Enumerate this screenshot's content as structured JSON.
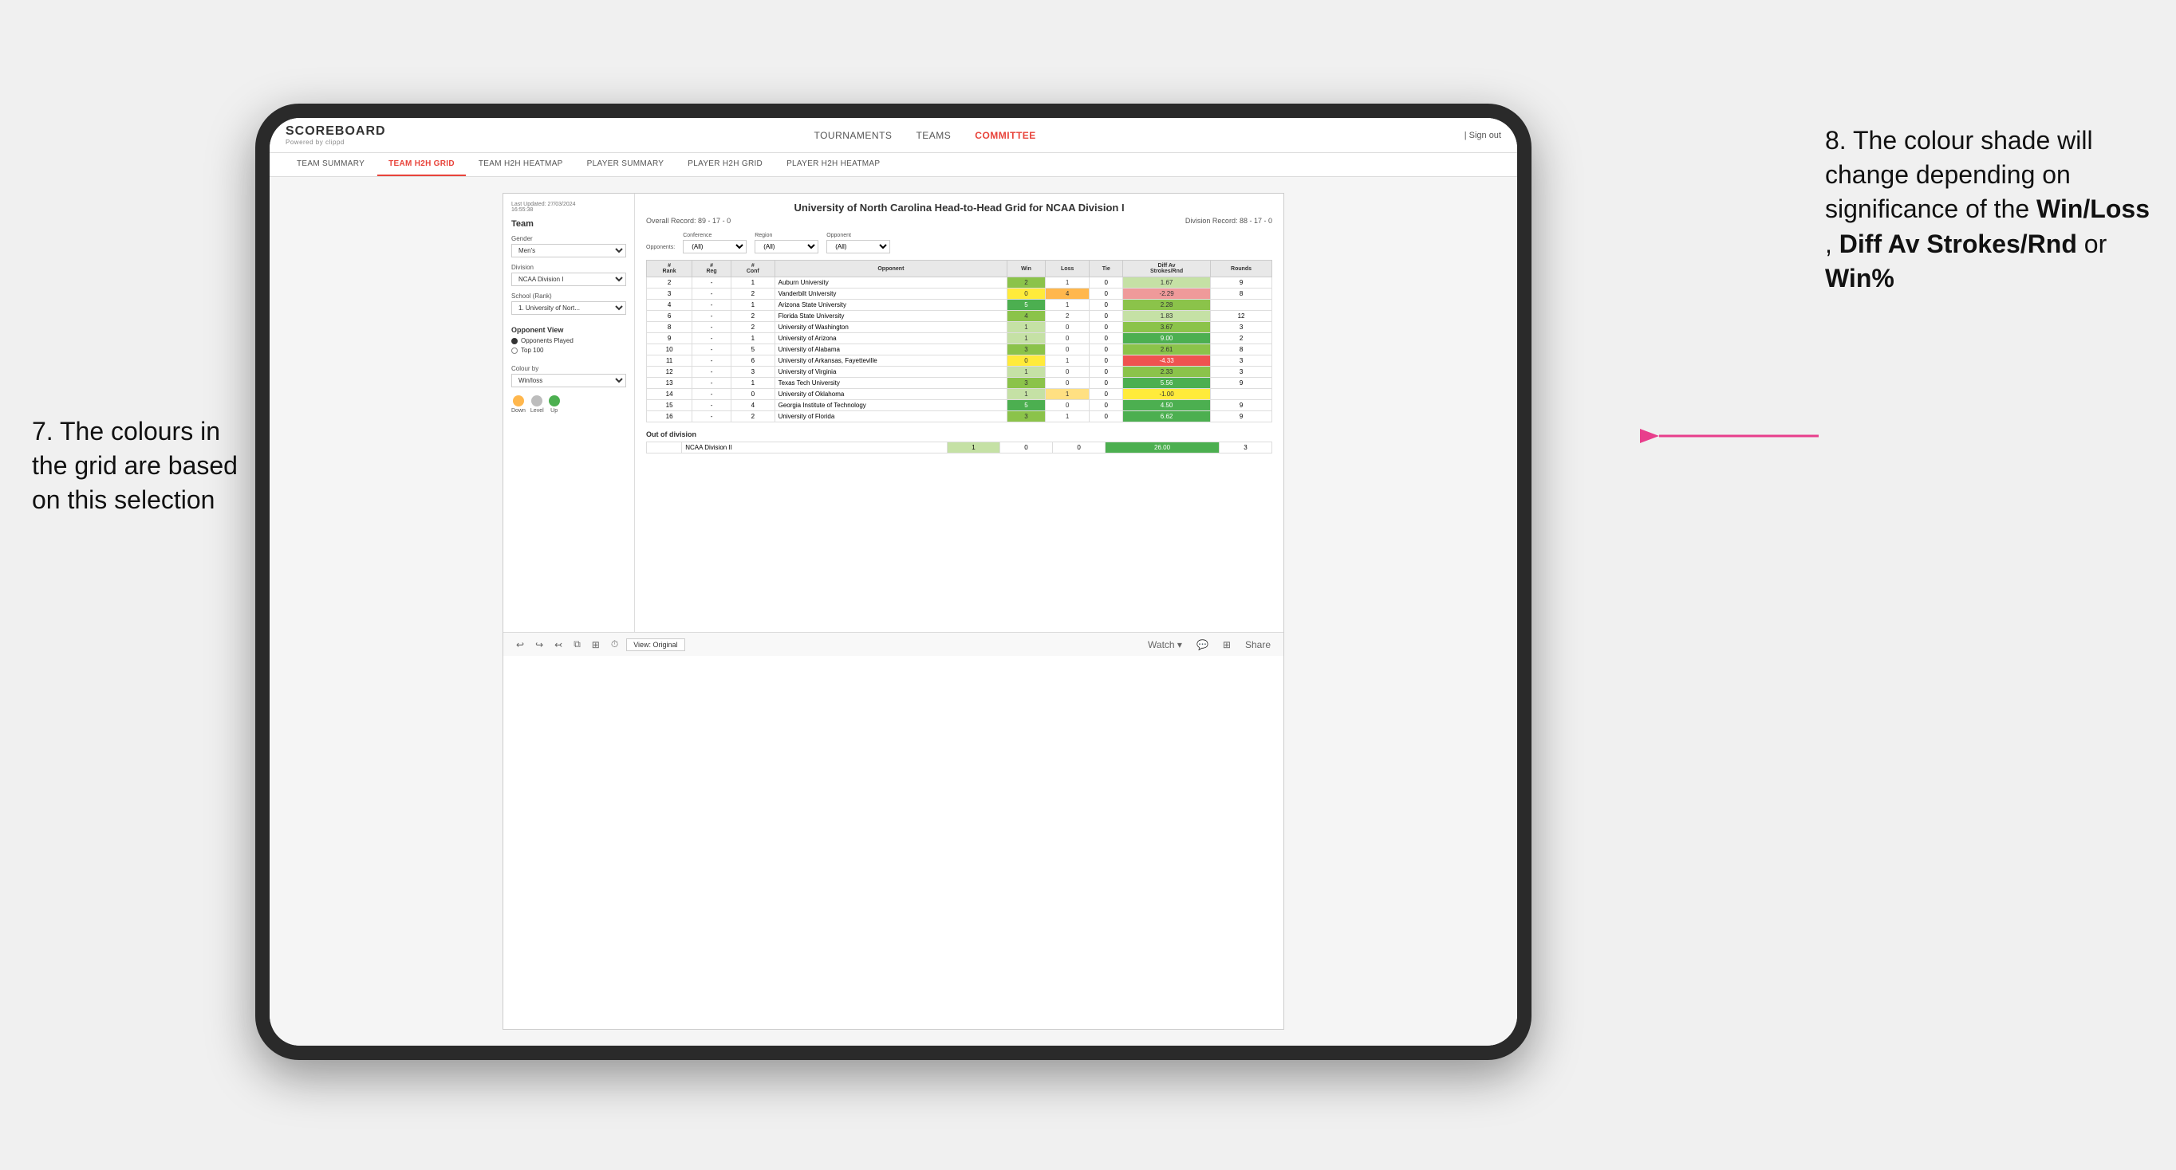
{
  "annotations": {
    "left": {
      "number": "7.",
      "text": "The colours in the grid are based on this selection"
    },
    "right": {
      "number": "8.",
      "text": " The colour shade will change depending on significance of the ",
      "bold1": "Win/Loss",
      "comma1": ", ",
      "bold2": "Diff Av Strokes/Rnd",
      "or": " or ",
      "bold3": "Win%"
    }
  },
  "nav": {
    "logo": "SCOREBOARD",
    "logo_sub": "Powered by clippd",
    "links": [
      "TOURNAMENTS",
      "TEAMS",
      "COMMITTEE"
    ],
    "sign_out": "| Sign out"
  },
  "sub_tabs": [
    "TEAM SUMMARY",
    "TEAM H2H GRID",
    "TEAM H2H HEATMAP",
    "PLAYER SUMMARY",
    "PLAYER H2H GRID",
    "PLAYER H2H HEATMAP"
  ],
  "active_sub_tab": "TEAM H2H GRID",
  "report": {
    "last_updated_label": "Last Updated: 27/03/2024",
    "last_updated_time": "16:55:38",
    "title": "University of North Carolina Head-to-Head Grid for NCAA Division I",
    "overall_record_label": "Overall Record:",
    "overall_record": "89 - 17 - 0",
    "division_record_label": "Division Record:",
    "division_record": "88 - 17 - 0"
  },
  "sidebar": {
    "team_label": "Team",
    "gender_label": "Gender",
    "gender_value": "Men's",
    "division_label": "Division",
    "division_value": "NCAA Division I",
    "school_label": "School (Rank)",
    "school_value": "1. University of Nort...",
    "opponent_view_label": "Opponent View",
    "opponent_options": [
      "Opponents Played",
      "Top 100"
    ],
    "opponent_selected": "Opponents Played",
    "colour_by_label": "Colour by",
    "colour_by_value": "Win/loss",
    "legend": {
      "down": "Down",
      "level": "Level",
      "up": "Up"
    }
  },
  "filters": {
    "opponents_label": "Opponents:",
    "conference_label": "Conference",
    "conference_value": "(All)",
    "region_label": "Region",
    "region_value": "(All)",
    "opponent_label": "Opponent",
    "opponent_value": "(All)"
  },
  "table": {
    "headers": [
      "#\nRank",
      "#\nReg",
      "#\nConf",
      "Opponent",
      "Win",
      "Loss",
      "Tie",
      "Diff Av\nStrokes/Rnd",
      "Rounds"
    ],
    "rows": [
      {
        "rank": "2",
        "reg": "-",
        "conf": "1",
        "opponent": "Auburn University",
        "win": "2",
        "loss": "1",
        "tie": "0",
        "diff": "1.67",
        "rounds": "9",
        "win_color": "green_mid",
        "loss_color": "white",
        "diff_color": "green_light"
      },
      {
        "rank": "3",
        "reg": "-",
        "conf": "2",
        "opponent": "Vanderbilt University",
        "win": "0",
        "loss": "4",
        "tie": "0",
        "diff": "-2.29",
        "rounds": "8",
        "win_color": "yellow",
        "loss_color": "orange",
        "diff_color": "red_light"
      },
      {
        "rank": "4",
        "reg": "-",
        "conf": "1",
        "opponent": "Arizona State University",
        "win": "5",
        "loss": "1",
        "tie": "0",
        "diff": "2.28",
        "rounds": "",
        "win_color": "green_dark",
        "loss_color": "white",
        "diff_color": "green_mid"
      },
      {
        "rank": "6",
        "reg": "-",
        "conf": "2",
        "opponent": "Florida State University",
        "win": "4",
        "loss": "2",
        "tie": "0",
        "diff": "1.83",
        "rounds": "12",
        "win_color": "green_mid",
        "loss_color": "white",
        "diff_color": "green_light"
      },
      {
        "rank": "8",
        "reg": "-",
        "conf": "2",
        "opponent": "University of Washington",
        "win": "1",
        "loss": "0",
        "tie": "0",
        "diff": "3.67",
        "rounds": "3",
        "win_color": "green_light",
        "loss_color": "white",
        "diff_color": "green_mid"
      },
      {
        "rank": "9",
        "reg": "-",
        "conf": "1",
        "opponent": "University of Arizona",
        "win": "1",
        "loss": "0",
        "tie": "0",
        "diff": "9.00",
        "rounds": "2",
        "win_color": "green_light",
        "loss_color": "white",
        "diff_color": "green_dark"
      },
      {
        "rank": "10",
        "reg": "-",
        "conf": "5",
        "opponent": "University of Alabama",
        "win": "3",
        "loss": "0",
        "tie": "0",
        "diff": "2.61",
        "rounds": "8",
        "win_color": "green_mid",
        "loss_color": "white",
        "diff_color": "green_mid"
      },
      {
        "rank": "11",
        "reg": "-",
        "conf": "6",
        "opponent": "University of Arkansas, Fayetteville",
        "win": "0",
        "loss": "1",
        "tie": "0",
        "diff": "-4.33",
        "rounds": "3",
        "win_color": "yellow",
        "loss_color": "white",
        "diff_color": "red"
      },
      {
        "rank": "12",
        "reg": "-",
        "conf": "3",
        "opponent": "University of Virginia",
        "win": "1",
        "loss": "0",
        "tie": "0",
        "diff": "2.33",
        "rounds": "3",
        "win_color": "green_light",
        "loss_color": "white",
        "diff_color": "green_mid"
      },
      {
        "rank": "13",
        "reg": "-",
        "conf": "1",
        "opponent": "Texas Tech University",
        "win": "3",
        "loss": "0",
        "tie": "0",
        "diff": "5.56",
        "rounds": "9",
        "win_color": "green_mid",
        "loss_color": "white",
        "diff_color": "green_dark"
      },
      {
        "rank": "14",
        "reg": "-",
        "conf": "0",
        "opponent": "University of Oklahoma",
        "win": "1",
        "loss": "1",
        "tie": "0",
        "diff": "-1.00",
        "rounds": "",
        "win_color": "green_light",
        "loss_color": "orange_light",
        "diff_color": "yellow"
      },
      {
        "rank": "15",
        "reg": "-",
        "conf": "4",
        "opponent": "Georgia Institute of Technology",
        "win": "5",
        "loss": "0",
        "tie": "0",
        "diff": "4.50",
        "rounds": "9",
        "win_color": "green_dark",
        "loss_color": "white",
        "diff_color": "green_dark"
      },
      {
        "rank": "16",
        "reg": "-",
        "conf": "2",
        "opponent": "University of Florida",
        "win": "3",
        "loss": "1",
        "tie": "0",
        "diff": "6.62",
        "rounds": "9",
        "win_color": "green_mid",
        "loss_color": "white",
        "diff_color": "green_dark"
      }
    ],
    "out_of_division_label": "Out of division",
    "out_of_division_row": {
      "division": "NCAA Division II",
      "win": "1",
      "loss": "0",
      "tie": "0",
      "diff": "26.00",
      "rounds": "3",
      "win_color": "green_light",
      "diff_color": "green_dark"
    }
  },
  "bottom_toolbar": {
    "view_label": "View: Original",
    "watch_label": "Watch ▾",
    "share_label": "Share"
  }
}
